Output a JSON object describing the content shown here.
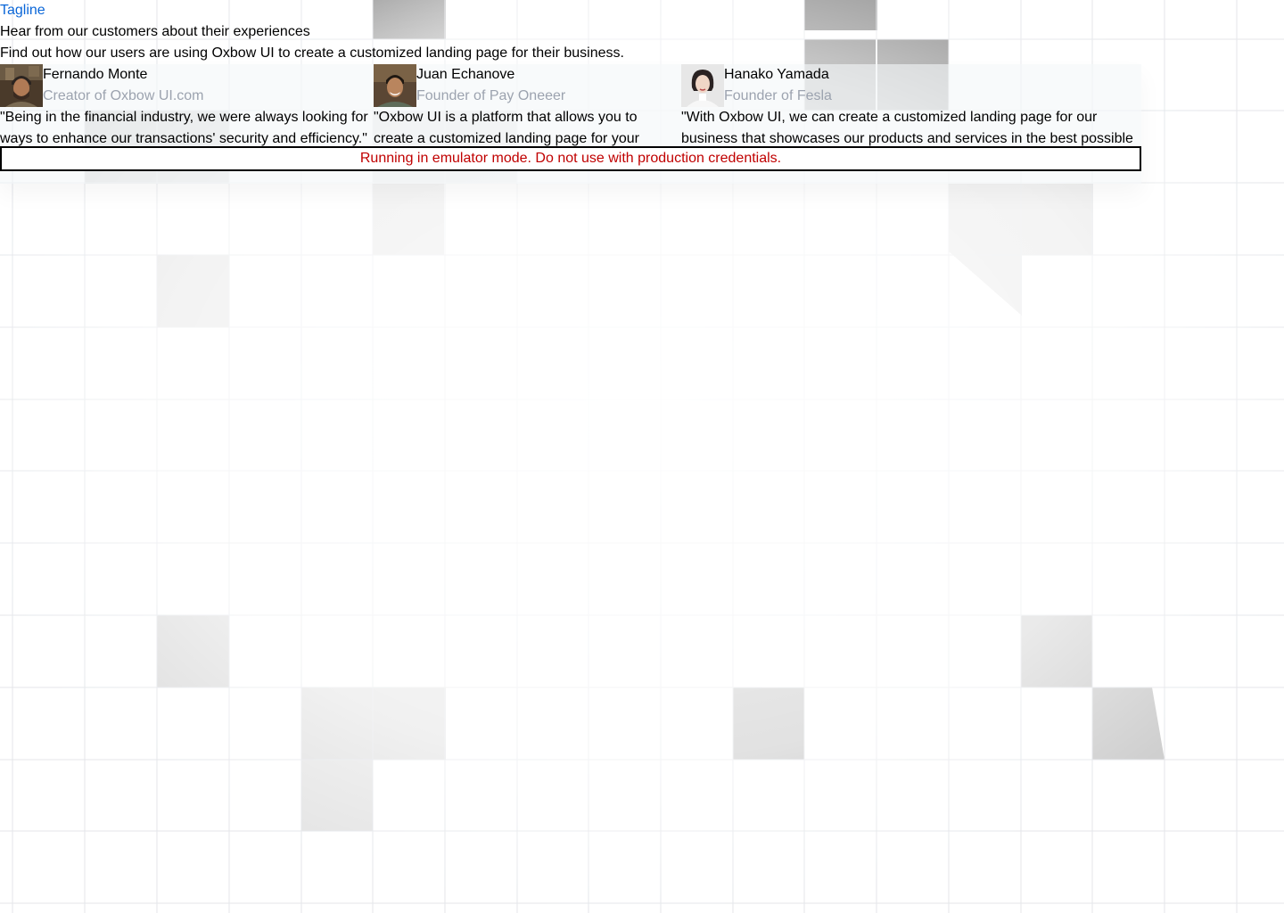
{
  "colors": {
    "tagline": "#0a66d8",
    "muted_text": "#9ca3af",
    "banner_text": "#c00000",
    "banner_border": "#000000"
  },
  "header": {
    "tagline": "Tagline",
    "heading": "Hear from our customers about their experiences",
    "subheading": "Find out how our users are using Oxbow UI to create a customized landing page for their business."
  },
  "testimonials": [
    {
      "name": "Fernando Monte",
      "role": "Creator of Oxbow UI.com",
      "quote": "\"Being in the financial industry, we were always looking for ways to enhance our transactions' security and efficiency.\"",
      "avatar_icon": "avatar-photo-man-cap"
    },
    {
      "name": "Juan Echanove",
      "role": "Founder of Pay Oneeer",
      "quote": "\"Oxbow UI is a platform that allows you to create a customized landing page for your",
      "avatar_icon": "avatar-photo-man-smiling"
    },
    {
      "name": "Hanako Yamada",
      "role": "Founder of Fesla",
      "quote": "\"With Oxbow UI, we can create a customized landing page for our business that showcases our products and services in the best possible",
      "avatar_icon": "avatar-photo-woman"
    }
  ],
  "banner": {
    "text": "Running in emulator mode. Do not use with production credentials."
  }
}
